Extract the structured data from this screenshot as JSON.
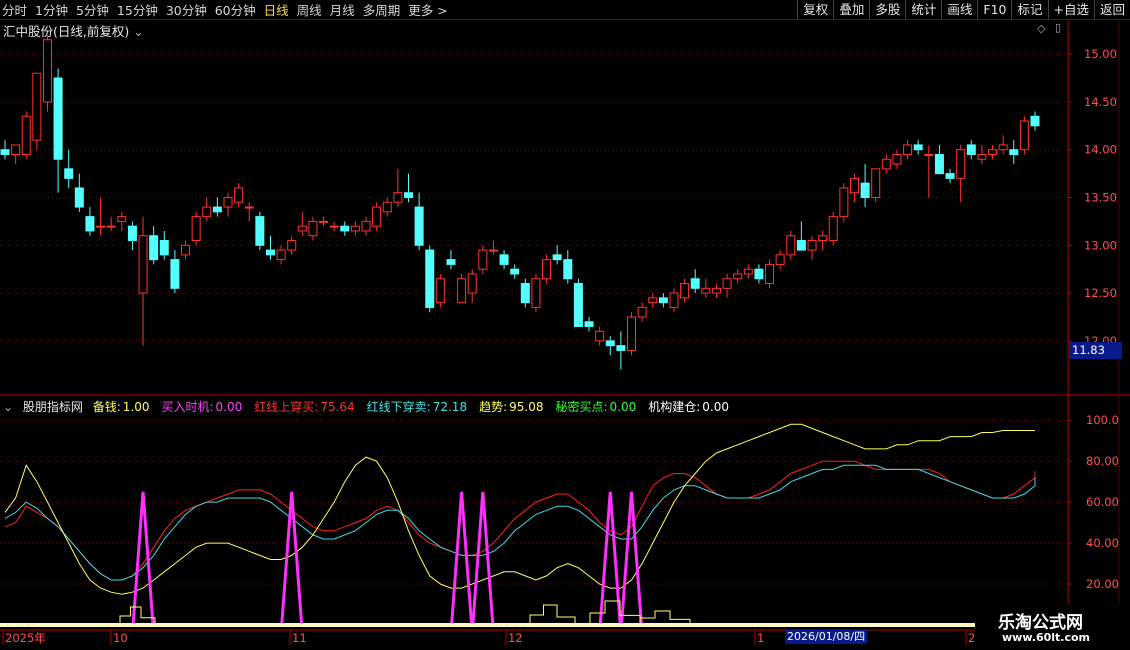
{
  "toolbar": {
    "periods": [
      "分时",
      "1分钟",
      "5分钟",
      "15分钟",
      "30分钟",
      "60分钟",
      "日线",
      "周线",
      "月线",
      "多周期",
      "更多 >"
    ],
    "active_period": "日线",
    "actions": [
      "复权",
      "叠加",
      "多股",
      "统计",
      "画线",
      "F10",
      "标记",
      "+自选",
      "返回"
    ]
  },
  "stock": {
    "title": "汇中股份(日线,前复权)"
  },
  "price_axis": {
    "ticks": [
      "15.00",
      "14.50",
      "14.00",
      "13.50",
      "13.00",
      "12.50",
      "12.00"
    ],
    "current": "11.83"
  },
  "indicator": {
    "name": "股朋指标网",
    "items": [
      {
        "label": "备钱:",
        "value": "1.00",
        "color": "#ffff66"
      },
      {
        "label": "买入时机:",
        "value": "0.00",
        "color": "#ff40ff"
      },
      {
        "label": "红线上穿买:",
        "value": "75.64",
        "color": "#ff3030"
      },
      {
        "label": "红线下穿卖:",
        "value": "72.18",
        "color": "#40e0e0"
      },
      {
        "label": "趋势:",
        "value": "95.08",
        "color": "#ffff66"
      },
      {
        "label": "秘密买点:",
        "value": "0.00",
        "color": "#30ff30"
      },
      {
        "label": "机构建仓:",
        "value": "0.00",
        "color": "#ffffff"
      }
    ],
    "axis_ticks": [
      "100.0",
      "80.00",
      "60.00",
      "40.00",
      "20.00"
    ]
  },
  "time_axis": {
    "labels": [
      "2025年",
      "10",
      "11",
      "12",
      "1",
      "2"
    ],
    "cursor_date": "2026/01/08/四"
  },
  "watermark": {
    "title": "乐淘公式网",
    "url": "www.60lt.com"
  },
  "colors": {
    "up": "#ff3232",
    "down": "#54ffff",
    "grid": "#7a0000",
    "axis": "#b30000"
  },
  "chart_data": {
    "type": "candlestick",
    "candles": [
      [
        14.0,
        14.1,
        13.9,
        13.95
      ],
      [
        13.95,
        14.05,
        13.85,
        14.05
      ],
      [
        13.95,
        14.4,
        13.9,
        14.35
      ],
      [
        14.1,
        14.8,
        14.0,
        14.8
      ],
      [
        14.5,
        15.2,
        14.4,
        15.15
      ],
      [
        14.75,
        14.85,
        13.55,
        13.9
      ],
      [
        13.8,
        14.0,
        13.6,
        13.7
      ],
      [
        13.6,
        13.75,
        13.35,
        13.4
      ],
      [
        13.3,
        13.4,
        13.1,
        13.15
      ],
      [
        13.2,
        13.5,
        13.1,
        13.2
      ],
      [
        13.2,
        13.3,
        13.15,
        13.2
      ],
      [
        13.25,
        13.35,
        13.15,
        13.3
      ],
      [
        13.2,
        13.25,
        12.95,
        13.05
      ],
      [
        12.5,
        13.3,
        11.95,
        13.1
      ],
      [
        13.1,
        13.2,
        12.8,
        12.85
      ],
      [
        13.05,
        13.15,
        12.85,
        12.9
      ],
      [
        12.85,
        12.95,
        12.5,
        12.55
      ],
      [
        12.9,
        13.05,
        12.85,
        13.0
      ],
      [
        13.05,
        13.35,
        13.0,
        13.3
      ],
      [
        13.3,
        13.5,
        13.25,
        13.4
      ],
      [
        13.4,
        13.5,
        13.3,
        13.35
      ],
      [
        13.4,
        13.55,
        13.3,
        13.5
      ],
      [
        13.45,
        13.65,
        13.4,
        13.6
      ],
      [
        13.4,
        13.45,
        13.25,
        13.4
      ],
      [
        13.3,
        13.35,
        12.95,
        13.0
      ],
      [
        12.95,
        13.1,
        12.85,
        12.9
      ],
      [
        12.85,
        13.0,
        12.8,
        12.95
      ],
      [
        12.95,
        13.1,
        12.9,
        13.05
      ],
      [
        13.15,
        13.35,
        13.1,
        13.2
      ],
      [
        13.1,
        13.3,
        13.05,
        13.25
      ],
      [
        13.25,
        13.3,
        13.2,
        13.25
      ],
      [
        13.2,
        13.25,
        13.15,
        13.2
      ],
      [
        13.2,
        13.25,
        13.1,
        13.15
      ],
      [
        13.15,
        13.25,
        13.1,
        13.2
      ],
      [
        13.15,
        13.3,
        13.1,
        13.25
      ],
      [
        13.2,
        13.45,
        13.15,
        13.4
      ],
      [
        13.35,
        13.5,
        13.3,
        13.45
      ],
      [
        13.45,
        13.8,
        13.4,
        13.55
      ],
      [
        13.55,
        13.75,
        13.45,
        13.5
      ],
      [
        13.4,
        13.55,
        12.95,
        13.0
      ],
      [
        12.95,
        13.0,
        12.3,
        12.35
      ],
      [
        12.4,
        12.7,
        12.35,
        12.65
      ],
      [
        12.85,
        12.95,
        12.75,
        12.8
      ],
      [
        12.4,
        12.7,
        12.4,
        12.65
      ],
      [
        12.5,
        12.75,
        12.4,
        12.7
      ],
      [
        12.75,
        13.0,
        12.7,
        12.95
      ],
      [
        12.95,
        13.05,
        12.9,
        12.95
      ],
      [
        12.9,
        12.95,
        12.75,
        12.8
      ],
      [
        12.75,
        12.8,
        12.65,
        12.7
      ],
      [
        12.6,
        12.65,
        12.35,
        12.4
      ],
      [
        12.35,
        12.7,
        12.3,
        12.65
      ],
      [
        12.65,
        12.9,
        12.6,
        12.85
      ],
      [
        12.9,
        13.0,
        12.8,
        12.85
      ],
      [
        12.85,
        12.95,
        12.6,
        12.65
      ],
      [
        12.6,
        12.65,
        12.15,
        12.15
      ],
      [
        12.2,
        12.25,
        12.1,
        12.15
      ],
      [
        12.0,
        12.15,
        11.95,
        12.1
      ],
      [
        12.0,
        12.05,
        11.85,
        11.95
      ],
      [
        11.95,
        12.1,
        11.7,
        11.9
      ],
      [
        11.9,
        12.3,
        11.85,
        12.25
      ],
      [
        12.25,
        12.4,
        12.2,
        12.35
      ],
      [
        12.4,
        12.5,
        12.35,
        12.45
      ],
      [
        12.45,
        12.5,
        12.35,
        12.4
      ],
      [
        12.35,
        12.55,
        12.3,
        12.5
      ],
      [
        12.45,
        12.65,
        12.4,
        12.6
      ],
      [
        12.65,
        12.75,
        12.5,
        12.55
      ],
      [
        12.5,
        12.65,
        12.45,
        12.55
      ],
      [
        12.5,
        12.6,
        12.45,
        12.55
      ],
      [
        12.55,
        12.7,
        12.45,
        12.65
      ],
      [
        12.65,
        12.75,
        12.6,
        12.7
      ],
      [
        12.7,
        12.8,
        12.65,
        12.75
      ],
      [
        12.75,
        12.8,
        12.6,
        12.65
      ],
      [
        12.6,
        12.85,
        12.55,
        12.8
      ],
      [
        12.8,
        12.95,
        12.75,
        12.9
      ],
      [
        12.9,
        13.15,
        12.85,
        13.1
      ],
      [
        13.05,
        13.25,
        12.95,
        12.95
      ],
      [
        12.95,
        13.1,
        12.85,
        13.05
      ],
      [
        13.05,
        13.15,
        12.95,
        13.1
      ],
      [
        13.05,
        13.35,
        13.0,
        13.3
      ],
      [
        13.3,
        13.65,
        13.25,
        13.6
      ],
      [
        13.55,
        13.75,
        13.45,
        13.7
      ],
      [
        13.65,
        13.85,
        13.4,
        13.5
      ],
      [
        13.5,
        13.8,
        13.45,
        13.8
      ],
      [
        13.8,
        13.95,
        13.75,
        13.9
      ],
      [
        13.85,
        14.0,
        13.8,
        13.95
      ],
      [
        13.95,
        14.1,
        13.9,
        14.05
      ],
      [
        14.05,
        14.1,
        13.95,
        14.0
      ],
      [
        13.95,
        14.05,
        13.5,
        13.95
      ],
      [
        13.95,
        14.05,
        13.75,
        13.75
      ],
      [
        13.75,
        13.8,
        13.65,
        13.7
      ],
      [
        13.7,
        14.05,
        13.45,
        14.0
      ],
      [
        14.05,
        14.1,
        13.9,
        13.95
      ],
      [
        13.9,
        14.05,
        13.85,
        13.95
      ],
      [
        13.95,
        14.05,
        13.9,
        14.0
      ],
      [
        14.0,
        14.15,
        13.95,
        14.05
      ],
      [
        14.0,
        14.1,
        13.85,
        13.95
      ],
      [
        14.0,
        14.35,
        13.95,
        14.3
      ],
      [
        14.35,
        14.4,
        14.2,
        14.25
      ]
    ],
    "series": [
      {
        "name": "红线上穿买",
        "values": [
          48,
          50,
          58,
          55,
          52,
          48,
          42,
          36,
          30,
          25,
          22,
          22,
          24,
          30,
          38,
          46,
          52,
          56,
          58,
          60,
          62,
          64,
          66,
          66,
          66,
          64,
          60,
          56,
          52,
          48,
          46,
          46,
          48,
          50,
          52,
          56,
          58,
          56,
          50,
          44,
          40,
          38,
          36,
          34,
          34,
          36,
          40,
          46,
          52,
          56,
          60,
          62,
          64,
          64,
          60,
          56,
          50,
          46,
          44,
          48,
          58,
          68,
          72,
          74,
          74,
          72,
          68,
          64,
          62,
          62,
          62,
          64,
          66,
          70,
          74,
          76,
          78,
          80,
          80,
          80,
          80,
          78,
          76,
          76,
          76,
          76,
          76,
          76,
          74,
          70,
          68,
          66,
          64,
          62,
          62,
          64,
          68,
          72,
          75
        ]
      },
      {
        "name": "红线下穿卖",
        "values": [
          52,
          55,
          60,
          57,
          52,
          48,
          42,
          36,
          30,
          25,
          22,
          22,
          24,
          28,
          34,
          42,
          48,
          54,
          58,
          60,
          60,
          62,
          62,
          62,
          62,
          60,
          56,
          52,
          48,
          44,
          42,
          42,
          44,
          46,
          50,
          54,
          56,
          56,
          52,
          46,
          42,
          38,
          36,
          34,
          34,
          34,
          36,
          40,
          46,
          50,
          54,
          56,
          58,
          58,
          56,
          52,
          48,
          44,
          42,
          42,
          48,
          56,
          62,
          66,
          68,
          68,
          66,
          64,
          62,
          62,
          62,
          62,
          64,
          66,
          70,
          72,
          74,
          76,
          76,
          78,
          78,
          78,
          78,
          76,
          76,
          76,
          76,
          74,
          72,
          70,
          68,
          66,
          64,
          62,
          62,
          62,
          64,
          68,
          72
        ]
      },
      {
        "name": "趋势",
        "values": [
          55,
          62,
          78,
          70,
          60,
          50,
          40,
          30,
          22,
          18,
          16,
          15,
          16,
          18,
          22,
          26,
          30,
          34,
          38,
          40,
          40,
          40,
          38,
          36,
          34,
          32,
          32,
          34,
          38,
          44,
          52,
          60,
          70,
          78,
          82,
          80,
          72,
          60,
          46,
          34,
          24,
          20,
          18,
          18,
          20,
          22,
          24,
          26,
          26,
          24,
          22,
          24,
          28,
          30,
          28,
          24,
          20,
          18,
          18,
          22,
          30,
          40,
          50,
          60,
          68,
          74,
          80,
          84,
          86,
          88,
          90,
          92,
          94,
          96,
          98,
          98,
          96,
          94,
          92,
          90,
          88,
          86,
          86,
          86,
          88,
          88,
          90,
          90,
          90,
          92,
          92,
          92,
          94,
          94,
          95,
          95,
          95,
          95,
          95
        ]
      }
    ],
    "signal_peaks": [
      13,
      27,
      43,
      45,
      57,
      59
    ],
    "ylim_price": [
      11.8,
      15.2
    ],
    "ylim_indicator": [
      0,
      100
    ]
  }
}
